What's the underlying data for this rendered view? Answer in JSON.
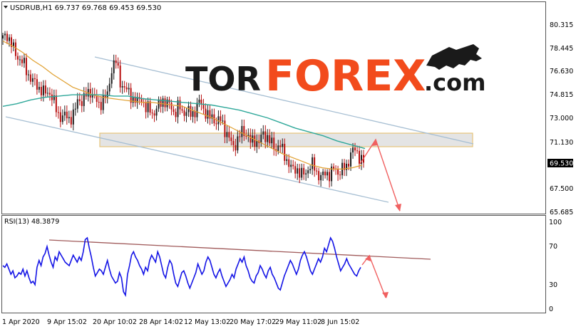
{
  "header": {
    "symbol_info": "USDRUB,H1  69.737 69.768 69.453 69.530"
  },
  "brand": {
    "text_dark": "TOR",
    "text_accent": "FOREX",
    "suffix": ".com",
    "dark_color": "#1a1a1a",
    "accent_color": "#f24b1c"
  },
  "colors": {
    "bull_candle": "#1f1f1f",
    "bear_candle": "#b80f0f",
    "ma_fast": "#e0a030",
    "ma_slow": "#2fa89a",
    "channel": "#a7bfd3",
    "resistance_zone": "#e4e4e4",
    "resistance_border": "#e7c47a",
    "forecast_arrow": "#f06060",
    "rsi_line": "#1414e6",
    "rsi_trendline": "#a05a5a",
    "price_marker_bg": "#000000"
  },
  "chart_data": [
    {
      "type": "candlestick",
      "name": "USDRUB,H1",
      "ohlc_last": {
        "open": 69.737,
        "high": 69.768,
        "low": 69.453,
        "close": 69.53
      },
      "y_ticks": [
        "80.315",
        "78.445",
        "76.630",
        "74.815",
        "73.000",
        "71.130",
        "69.530",
        "67.500",
        "65.685"
      ],
      "ylim": [
        65.685,
        80.315
      ],
      "current_price": "69.530",
      "x_ticks": [
        "1 Apr 2020",
        "9 Apr 15:02",
        "20 Apr 10:02",
        "28 Apr 14:02",
        "12 May 13:02",
        "20 May 17:02",
        "29 May 11:02",
        "8 Jun 15:02"
      ],
      "close_series": [
        79.2,
        79.5,
        78.8,
        78.0,
        77.6,
        77.2,
        76.4,
        75.9,
        75.6,
        75.2,
        74.9,
        75.1,
        74.4,
        73.4,
        73.0,
        73.2,
        72.9,
        73.3,
        74.6,
        74.2,
        74.9,
        75.1,
        74.4,
        74.0,
        74.5,
        74.8,
        77.0,
        77.4,
        75.8,
        75.3,
        75.0,
        74.5,
        74.2,
        74.7,
        73.6,
        73.8,
        73.2,
        73.9,
        74.5,
        74.0,
        74.1,
        73.2,
        74.0,
        73.4,
        73.5,
        73.3,
        73.6,
        74.4,
        73.6,
        73.0,
        73.1,
        72.6,
        72.9,
        72.0,
        71.3,
        70.8,
        71.2,
        72.0,
        71.8,
        71.1,
        71.3,
        71.0,
        71.8,
        71.5,
        71.0,
        70.6,
        70.9,
        70.2,
        69.5,
        68.9,
        69.1,
        68.5,
        68.7,
        69.1,
        69.4,
        68.6,
        68.3,
        68.8,
        68.5,
        69.1,
        68.7,
        69.0,
        69.2,
        70.3,
        70.5,
        70.0,
        69.5
      ],
      "ma_fast_series": [
        79.0,
        78.6,
        78.1,
        77.5,
        77.0,
        76.4,
        75.9,
        75.4,
        75.1,
        74.8,
        74.6,
        74.5,
        74.4,
        74.3,
        74.2,
        74.2,
        74.1,
        74.0,
        73.9,
        73.6,
        73.3,
        73.0,
        72.6,
        72.2,
        71.8,
        71.4,
        71.0,
        70.6,
        70.2,
        69.9,
        69.6,
        69.3,
        69.1,
        69.0,
        69.0,
        69.1,
        69.3
      ],
      "ma_slow_series": [
        73.9,
        74.1,
        74.4,
        74.6,
        74.7,
        74.8,
        74.8,
        74.8,
        74.7,
        74.7,
        74.5,
        74.4,
        74.3,
        74.2,
        74.1,
        74.0,
        73.8,
        73.6,
        73.3,
        73.0,
        72.6,
        72.2,
        71.9,
        71.6,
        71.2,
        70.9,
        70.6
      ],
      "resistance_zone": [
        70.9,
        71.7
      ],
      "forecast": [
        70.0,
        71.4,
        65.6
      ]
    },
    {
      "type": "line",
      "name": "RSI(13)",
      "label": "RSI(13) 48.3879",
      "y_ticks": [
        "100",
        "70",
        "30",
        "0"
      ],
      "ylim": [
        0,
        100
      ],
      "values": [
        50,
        48,
        52,
        46,
        40,
        44,
        36,
        38,
        42,
        40,
        46,
        38,
        44,
        36,
        30,
        32,
        28,
        48,
        56,
        50,
        60,
        64,
        72,
        62,
        54,
        48,
        60,
        56,
        66,
        62,
        58,
        54,
        52,
        50,
        56,
        62,
        58,
        54,
        60,
        56,
        66,
        80,
        82,
        70,
        60,
        48,
        38,
        42,
        46,
        44,
        40,
        48,
        56,
        46,
        38,
        34,
        30,
        32,
        42,
        36,
        20,
        16,
        40,
        50,
        62,
        66,
        60,
        56,
        50,
        46,
        40,
        48,
        44,
        56,
        62,
        58,
        54,
        66,
        60,
        50,
        40,
        36,
        48,
        56,
        52,
        40,
        30,
        26,
        34,
        42,
        44,
        38,
        30,
        24,
        30,
        36,
        42,
        52,
        46,
        40,
        44,
        54,
        60,
        56,
        48,
        40,
        36,
        42,
        46,
        38,
        32,
        26,
        30,
        34,
        40,
        36,
        46,
        52,
        58,
        54,
        60,
        50,
        44,
        36,
        32,
        30,
        38,
        42,
        50,
        46,
        40,
        36,
        44,
        48,
        40,
        36,
        30,
        24,
        22,
        30,
        38,
        44,
        50,
        56,
        52,
        46,
        40,
        46,
        56,
        62,
        66,
        60,
        52,
        44,
        40,
        46,
        52,
        58,
        54,
        60,
        70,
        66,
        74,
        82,
        78,
        70,
        60,
        52,
        44,
        48,
        52,
        58,
        52,
        48,
        44,
        40,
        38,
        44,
        48
      ]
    }
  ]
}
